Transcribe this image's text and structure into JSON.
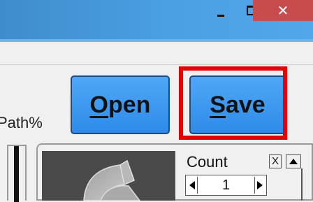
{
  "window": {
    "minimize_icon": "minimize-icon",
    "maximize_icon": "maximize-icon",
    "close_icon": "close-icon",
    "close_glyph": "✕"
  },
  "toolbar": {
    "path_label": "Path%",
    "open_button": {
      "accel": "O",
      "rest": "pen"
    },
    "save_button": {
      "accel": "S",
      "rest": "ave"
    }
  },
  "panel": {
    "count_label": "Count",
    "x_button_label": "X",
    "spinner_value": "1"
  },
  "colors": {
    "titlebar": "#4aa0e3",
    "close_button": "#c84b4d",
    "button_blue": "#3d99ef",
    "highlight_frame": "#e50000"
  }
}
